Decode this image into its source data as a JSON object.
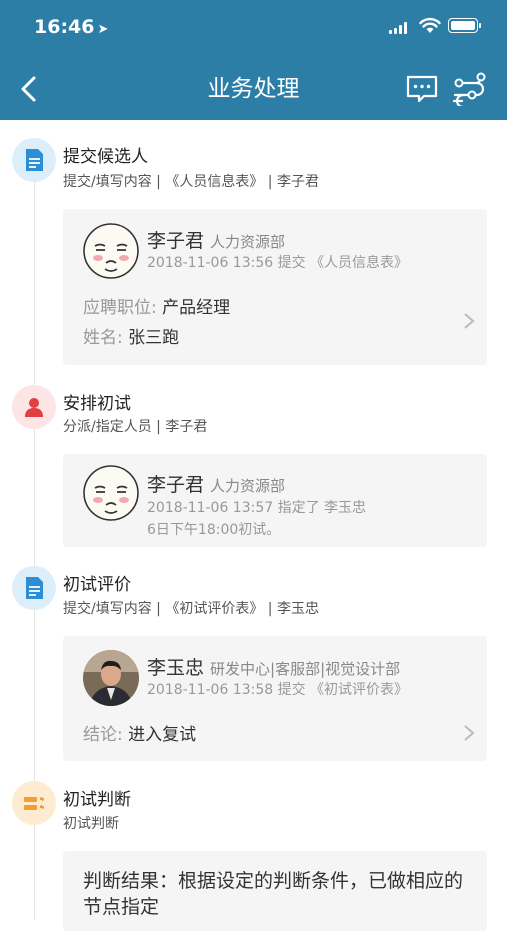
{
  "status": {
    "time": "16:46"
  },
  "nav": {
    "title": "业务处理"
  },
  "steps": [
    {
      "title": "提交候选人",
      "sub": "提交/填写内容 | 《人员信息表》 | 李子君",
      "card": {
        "name": "李子君",
        "dept": "人力资源部",
        "line1": "2018-11-06 13:56 提交 《人员信息表》",
        "fields": [
          {
            "label": "应聘职位:",
            "value": "产品经理"
          },
          {
            "label": "姓名:",
            "value": "张三跑"
          }
        ]
      }
    },
    {
      "title": "安排初试",
      "sub": "分派/指定人员 | 李子君",
      "card": {
        "name": "李子君",
        "dept": "人力资源部",
        "line1": "2018-11-06 13:57 指定了 李玉忠",
        "line2": "6日下午18:00初试。"
      }
    },
    {
      "title": "初试评价",
      "sub": "提交/填写内容 | 《初试评价表》 | 李玉忠",
      "card": {
        "name": "李玉忠",
        "dept": "研发中心|客服部|视觉设计部",
        "line1": "2018-11-06 13:58 提交 《初试评价表》",
        "fields": [
          {
            "label": "结论:",
            "value": "进入复试"
          }
        ]
      }
    },
    {
      "title": "初试判断",
      "sub": "初试判断",
      "card": {
        "text": "判断结果：根据设定的判断条件，已做相应的节点指定"
      }
    }
  ],
  "colors": {
    "header": "#2d7ea7",
    "blue_icon": "#2c8fd6",
    "red_icon": "#e0403f",
    "orange_icon": "#f0a030"
  }
}
